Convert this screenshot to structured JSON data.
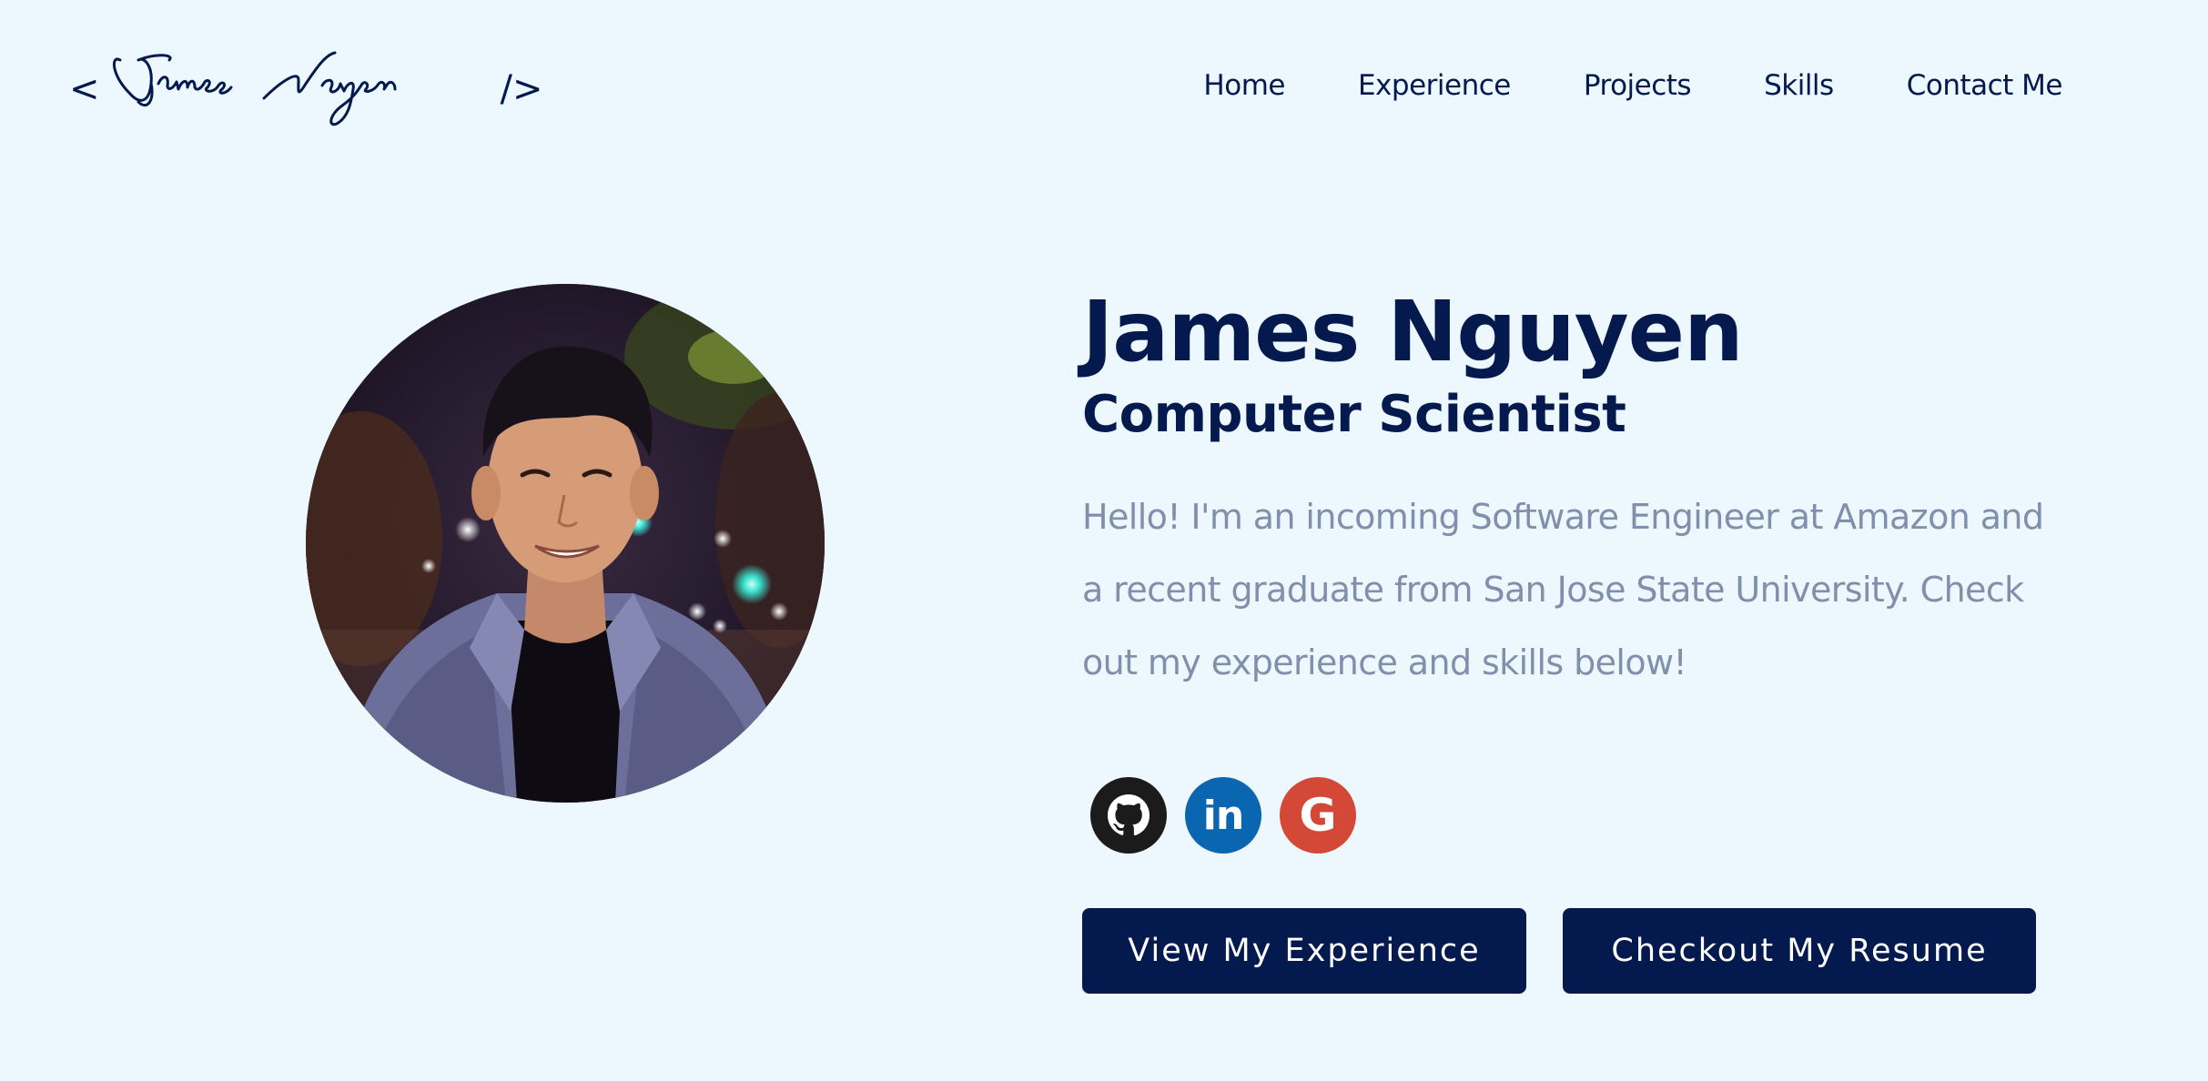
{
  "header": {
    "logo": {
      "open_bracket": "<",
      "signature": "James Nguyen",
      "close_bracket": "/>"
    },
    "nav": [
      {
        "label": "Home"
      },
      {
        "label": "Experience"
      },
      {
        "label": "Projects"
      },
      {
        "label": "Skills"
      },
      {
        "label": "Contact Me"
      }
    ]
  },
  "hero": {
    "name": "James Nguyen",
    "title": "Computer Scientist",
    "bio": "Hello! I'm an incoming Software Engineer at Amazon and a recent graduate from San Jose State University. Check out my experience and skills below!",
    "socials": [
      {
        "name": "github",
        "icon": "github-icon",
        "color": "#1b1b1b"
      },
      {
        "name": "linkedin",
        "icon": "linkedin-icon",
        "label": "in",
        "color": "#0a66b0"
      },
      {
        "name": "google",
        "icon": "google-icon",
        "label": "G",
        "color": "#d34836"
      }
    ],
    "buttons": {
      "experience": "View My Experience",
      "resume": "Checkout My Resume"
    }
  },
  "colors": {
    "background": "#ecf8fd",
    "primary": "#041a4e",
    "muted_text": "#8090ac"
  }
}
